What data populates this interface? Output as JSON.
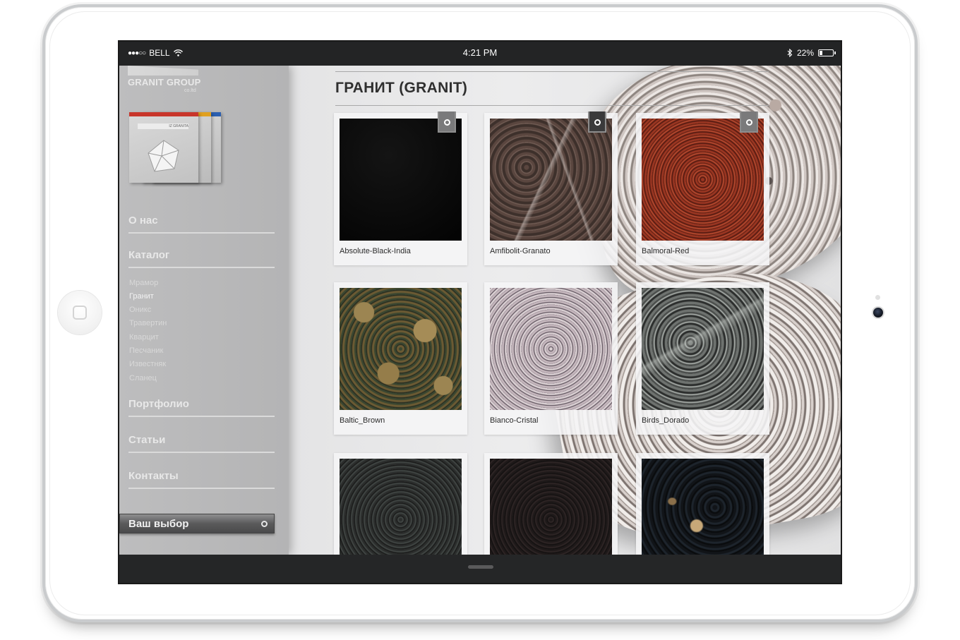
{
  "status_bar": {
    "signal": "●●●○○",
    "carrier": "BELL",
    "time": "4:21 PM",
    "battery": "22%",
    "battery_level": 0.22
  },
  "brand": {
    "name": "GRANIT GROUP",
    "suffix": "co.ltd",
    "catalog_cover_text": "IZ GRANITA"
  },
  "sidebar": {
    "about": "О нас",
    "catalog": "Каталог",
    "subitems": [
      "Мрамор",
      "Гранит",
      "Оникс",
      "Травертин",
      "Кварцит",
      "Песчаник",
      "Известняк",
      "Сланец"
    ],
    "portfolio": "Портфолио",
    "articles": "Статьи",
    "contacts": "Контакты",
    "choice": "Ваш выбор"
  },
  "main": {
    "title": "ГРАНИТ (GRANIT)",
    "tiles": [
      {
        "label": "Absolute-Black-India",
        "color": "#070707"
      },
      {
        "label": "Amfibolit-Granato",
        "color": "#4d3d37"
      },
      {
        "label": "Balmoral-Red",
        "color": "#8b2f1e"
      },
      {
        "label": "Baltic_Brown",
        "color": "#6b5a33"
      },
      {
        "label": "Bianco-Cristal",
        "color": "#c9bcc0"
      },
      {
        "label": "Birds_Dorado",
        "color": "#5e615f"
      },
      {
        "label": "",
        "color": "#2b2d2c"
      },
      {
        "label": "",
        "color": "#1e1919"
      },
      {
        "label": "",
        "color": "#111418"
      }
    ]
  },
  "icons": {
    "wifi": "wifi-icon",
    "bluetooth": "bluetooth-icon",
    "battery": "battery-icon",
    "add": "add-to-choice-icon"
  }
}
